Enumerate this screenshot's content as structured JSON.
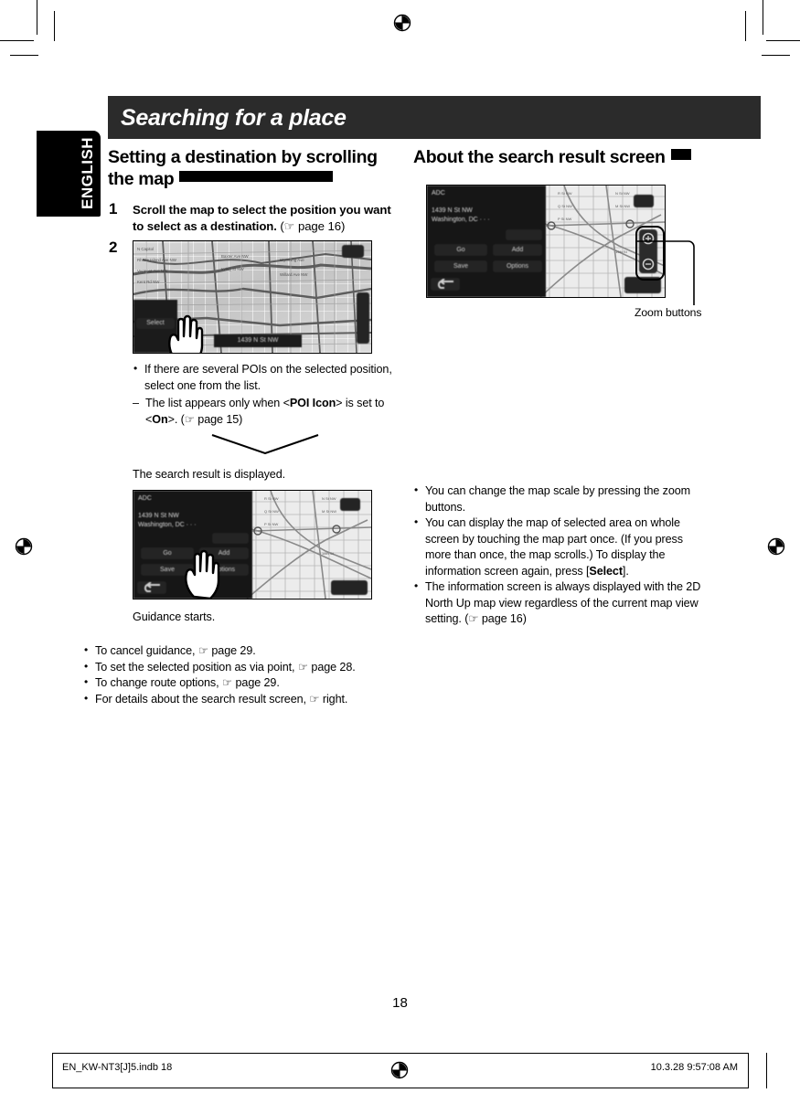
{
  "page": {
    "number": "18",
    "language_tab": "ENGLISH",
    "chapter_title": "Searching for a place"
  },
  "left_column": {
    "heading": "Setting a destination by scrolling the map",
    "steps": [
      {
        "num": "1",
        "text": "Scroll the map to select the position you want to select as a destination.",
        "ref": "(☞ page 16)"
      },
      {
        "num": "2",
        "text": "",
        "ref": ""
      }
    ],
    "step2_notes": {
      "bullets": [
        "If there are several POIs on the selected position, select one from the list."
      ],
      "sub_dash_prefix": "The list appears only when <",
      "sub_dash_bold1": "POI Icon",
      "sub_dash_mid": "> is set to <",
      "sub_dash_bold2": "On",
      "sub_dash_suffix": ">. (☞ page 15)"
    },
    "result_caption": "The search result is displayed.",
    "guidance_caption": "Guidance starts.",
    "footer_bullets": [
      "To cancel guidance, ☞ page 29.",
      "To set the selected position as via point, ☞ page 28.",
      "To change route options, ☞ page 29.",
      "For details about the search result screen, ☞ right."
    ],
    "screenshot_1": {
      "name": "map-scroll-screen",
      "select_button": "Select",
      "address_bar": "1439 N St NW",
      "labels": [
        "N Capitol",
        "K St NW",
        "Massachusetts Ave NW",
        "Rhode Island Ave NW",
        "Vermont Ave NW"
      ]
    },
    "screenshot_2": {
      "name": "search-result-screen",
      "title": "ADC",
      "address_line1": "1439 N St NW",
      "address_line2": "Washington, DC · · ·",
      "buttons": [
        "Go",
        "Save",
        "Add",
        "Options"
      ],
      "back_icon": "back-arrow-icon"
    }
  },
  "right_column": {
    "heading": "About the search result screen",
    "callout_label": "Zoom buttons",
    "bullets": [
      "You can change the map scale by pressing the zoom buttons.",
      "You can display the map of selected area on whole screen by touching the map part once. (If you press more than once, the map scrolls.) To display the information screen again, press [Select].",
      "The information screen is always displayed with the 2D North Up map view regardless of the current map view setting. (☞ page 16)"
    ],
    "bullet2_bold": "Select",
    "screenshot": {
      "name": "search-result-screen-annotated",
      "title": "ADC",
      "address_line1": "1439 N St NW",
      "address_line2": "Washington, DC · · ·",
      "buttons": [
        "Go",
        "Save",
        "Add",
        "Options"
      ],
      "zoom_in_icon": "zoom-in-icon",
      "zoom_out_icon": "zoom-out-icon"
    }
  },
  "footer": {
    "file_name": "EN_KW-NT3[J]5.indb   18",
    "timestamp": "10.3.28   9:57:08 AM"
  },
  "colors": {
    "title_bar_bg": "#2b2b2b",
    "tab_bg": "#000000",
    "text": "#000000",
    "paper": "#ffffff"
  }
}
